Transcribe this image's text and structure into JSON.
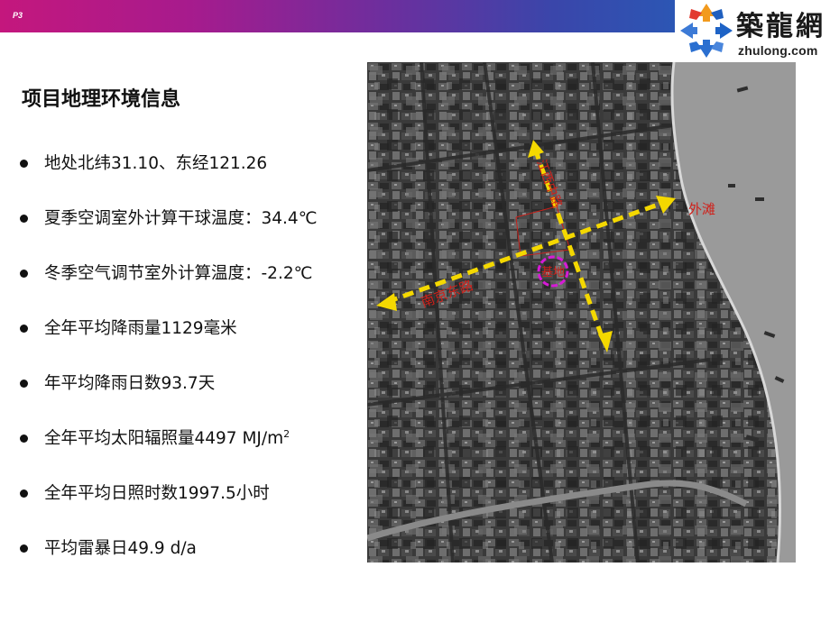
{
  "header": {
    "page_number": "P3"
  },
  "logo": {
    "name_cn": "築龍網",
    "url": "zhulong.com"
  },
  "title": "项目地理环境信息",
  "bullets": [
    {
      "text": "地处北纬31.10、东经121.26"
    },
    {
      "text": "夏季空调室外计算干球温度：34.4℃"
    },
    {
      "text": "冬季空气调节室外计算温度：-2.2℃"
    },
    {
      "text": "全年平均降雨量1129毫米"
    },
    {
      "text": "年平均降雨日数93.7天"
    },
    {
      "text": "全年平均太阳辐照量4497 MJ/m",
      "sup": "2"
    },
    {
      "text": "全年平均日照时数1997.5小时"
    },
    {
      "text": "平均雷暴日49.9 d/a"
    }
  ],
  "map": {
    "labels": {
      "bund": "外滩",
      "nanjing_east_road": "南京东路",
      "north_road": "江西中路",
      "site": "基地"
    },
    "colors": {
      "arrow": "#f4d800",
      "label": "#d0201a",
      "site_marker": "#d61ad6",
      "river": "#9a9a9a"
    }
  }
}
